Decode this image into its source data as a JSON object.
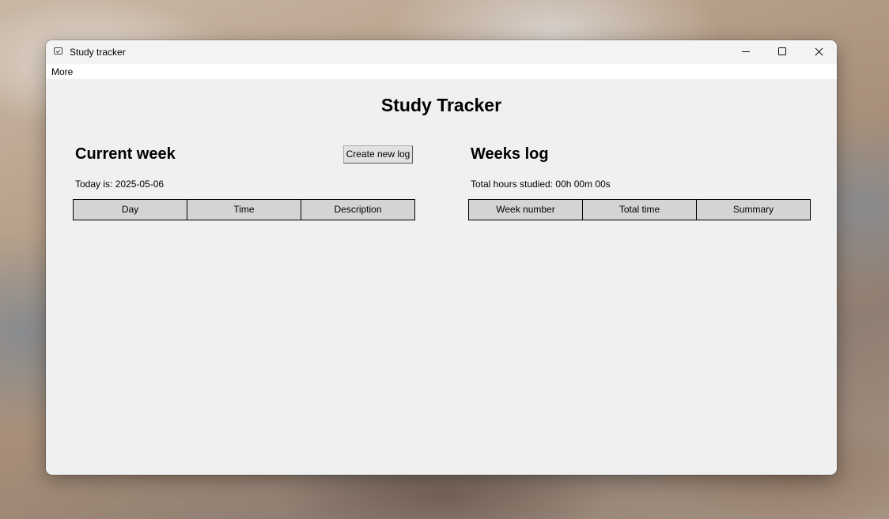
{
  "window": {
    "title": "Study tracker"
  },
  "menubar": {
    "items": [
      {
        "label": "More"
      }
    ]
  },
  "app": {
    "title": "Study Tracker"
  },
  "current_week": {
    "title": "Current week",
    "create_button": "Create new log",
    "today_text": "Today is: 2025-05-06",
    "columns": [
      "Day",
      "Time",
      "Description"
    ]
  },
  "weeks_log": {
    "title": "Weeks log",
    "total_text": "Total hours studied: 00h 00m 00s",
    "columns": [
      "Week number",
      "Total time",
      "Summary"
    ]
  },
  "icons": {
    "app": "app-window-icon",
    "minimize": "minimize-icon",
    "maximize": "maximize-icon",
    "close": "close-icon"
  },
  "colors": {
    "window_bg": "#f0f0f0",
    "header_cell_bg": "#d4d4d4",
    "button_bg": "#e1e1e1"
  }
}
